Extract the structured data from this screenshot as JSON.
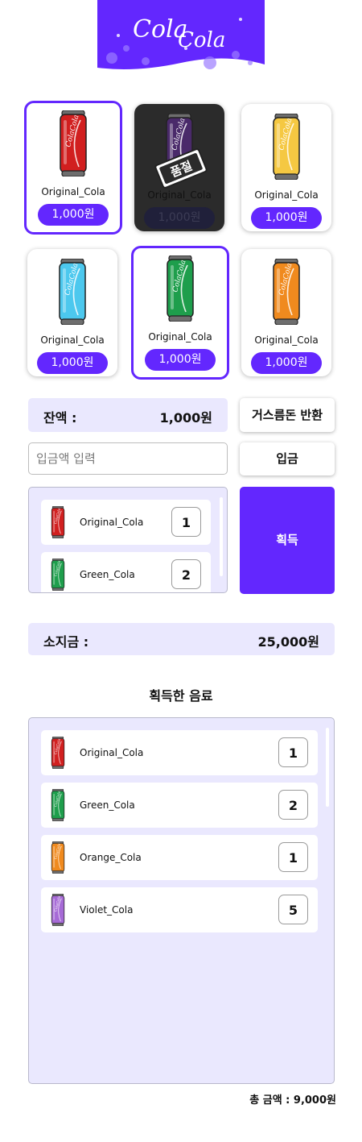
{
  "logo": {
    "text_top": "Cola",
    "text_bottom": "Cola",
    "brand_color": "#6327fe"
  },
  "products": [
    {
      "name": "Original_Cola",
      "price": "1,000원",
      "color": "#d11f1f",
      "state": "selected"
    },
    {
      "name": "Original_Cola",
      "price": "1,000원",
      "color": "#4a2a6a",
      "state": "soldout",
      "badge": "품절"
    },
    {
      "name": "Original_Cola",
      "price": "1,000원",
      "color": "#f5c842",
      "state": "normal"
    },
    {
      "name": "Original_Cola",
      "price": "1,000원",
      "color": "#4cc8ee",
      "state": "normal"
    },
    {
      "name": "Original_Cola",
      "price": "1,000원",
      "color": "#1e9e4c",
      "state": "selected"
    },
    {
      "name": "Original_Cola",
      "price": "1,000원",
      "color": "#f08a1e",
      "state": "normal"
    }
  ],
  "balance": {
    "label": "잔액 :",
    "value": "1,000원"
  },
  "return_button": "거스름돈 반환",
  "deposit": {
    "placeholder": "입금액 입력",
    "button": "입금"
  },
  "cart": [
    {
      "name": "Original_Cola",
      "count": "1",
      "color": "#d11f1f"
    },
    {
      "name": "Green_Cola",
      "count": "2",
      "color": "#1e9e4c"
    }
  ],
  "get_button": "획득",
  "wallet": {
    "label": "소지금 :",
    "value": "25,000원"
  },
  "acquired": {
    "title": "획득한 음료",
    "items": [
      {
        "name": "Original_Cola",
        "count": "1",
        "color": "#d11f1f"
      },
      {
        "name": "Green_Cola",
        "count": "2",
        "color": "#1e9e4c"
      },
      {
        "name": "Orange_Cola",
        "count": "1",
        "color": "#f08a1e"
      },
      {
        "name": "Violet_Cola",
        "count": "5",
        "color": "#a66ad6"
      }
    ],
    "total": "총 금액 : 9,000원"
  }
}
